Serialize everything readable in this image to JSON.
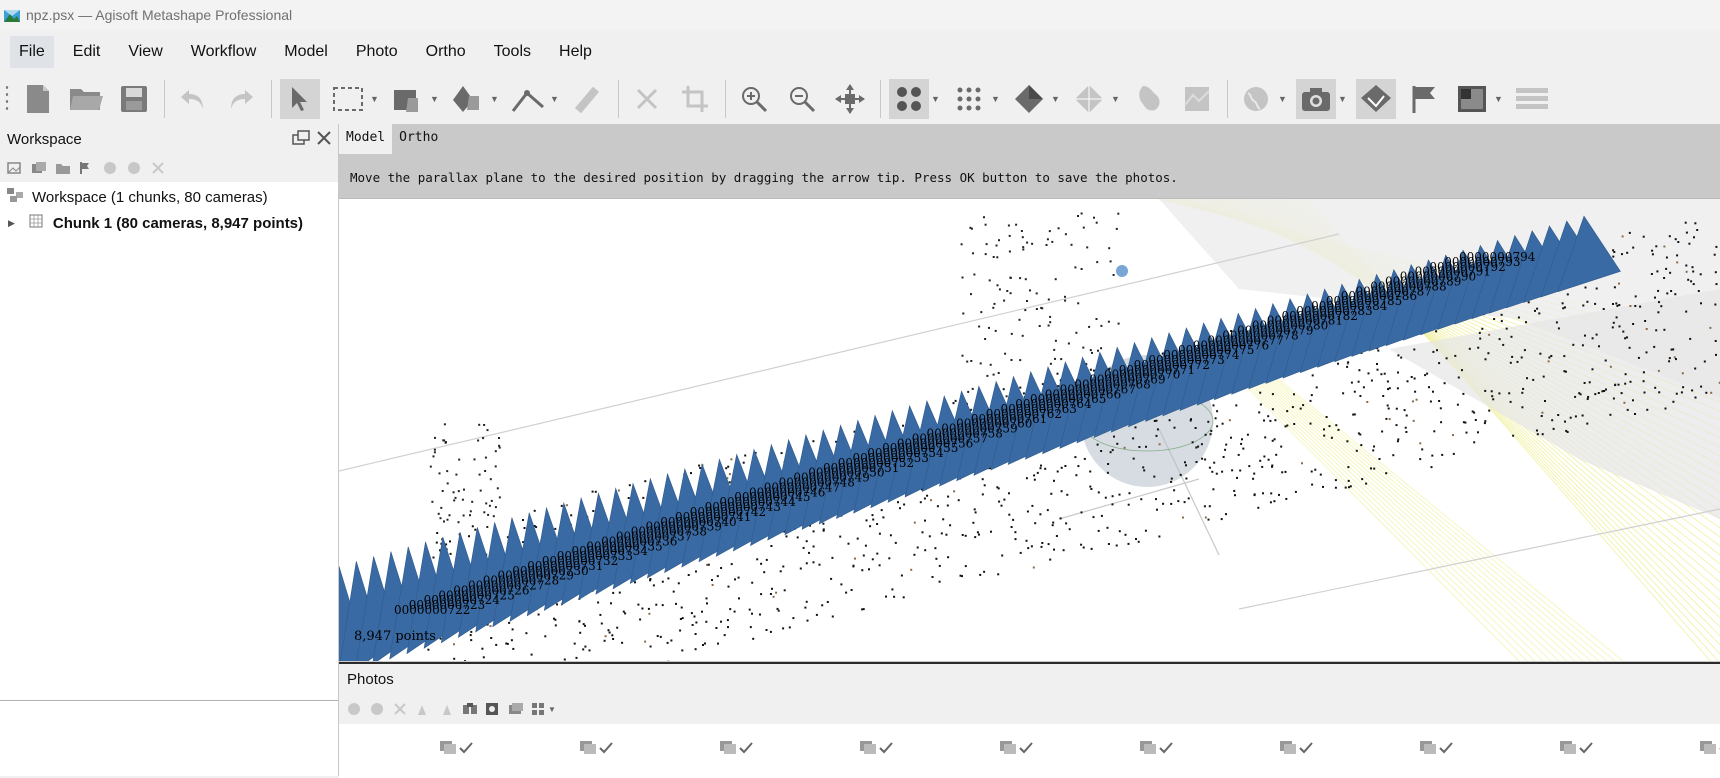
{
  "window": {
    "title": "npz.psx — Agisoft Metashape Professional"
  },
  "menu": [
    "File",
    "Edit",
    "View",
    "Workflow",
    "Model",
    "Photo",
    "Ortho",
    "Tools",
    "Help"
  ],
  "workspace": {
    "title": "Workspace",
    "tree": [
      {
        "label": "Workspace (1 chunks, 80 cameras)",
        "bold": false
      },
      {
        "label": "Chunk 1 (80 cameras, 8,947 points)",
        "bold": true
      }
    ]
  },
  "view": {
    "tabs": [
      "Model",
      "Ortho"
    ],
    "active_tab": "Model",
    "hint": "Move the parallax plane to the desired position by dragging the arrow tip. Press OK button to save the photos.",
    "points_label": "8,947 points",
    "camera_labels": [
      "0000000722",
      "0000000723",
      "0000000724",
      "0000000725",
      "0000000726",
      "0000000727",
      "0000000728",
      "0000000729",
      "0000000730",
      "0000000731",
      "0000000732",
      "0000000733",
      "0000000734",
      "0000000735",
      "0000000736",
      "0000000737",
      "0000000738",
      "0000000739",
      "0000000740",
      "0000000741",
      "0000000742",
      "0000000743",
      "0000000744",
      "0000000745",
      "0000000746",
      "0000000747",
      "0000000748",
      "0000000749",
      "0000000750",
      "0000000751",
      "0000000752",
      "0000000753",
      "0000000754",
      "0000000755",
      "0000000756",
      "0000000757",
      "0000000758",
      "0000000759",
      "0000000760",
      "0000000761",
      "0000000762",
      "0000000763",
      "0000000764",
      "0000000765",
      "0000000766",
      "0000000767",
      "0000000768",
      "0000000769",
      "0000000770",
      "0000000771",
      "0000000772",
      "0000000773",
      "0000000774",
      "0000000775",
      "0000000776",
      "0000000777",
      "0000000778",
      "0000000779",
      "0000000780",
      "0000000781",
      "0000000782",
      "0000000783",
      "0000000784",
      "0000000785",
      "0000000786",
      "0000000787",
      "0000000788",
      "0000000789",
      "0000000790",
      "0000000791",
      "0000000792",
      "0000000793",
      "0000000794"
    ]
  },
  "photos": {
    "title": "Photos",
    "thumb_count": 10
  },
  "colors": {
    "camera_blue": "#3a6aa3",
    "accent": "#4a90d9"
  }
}
